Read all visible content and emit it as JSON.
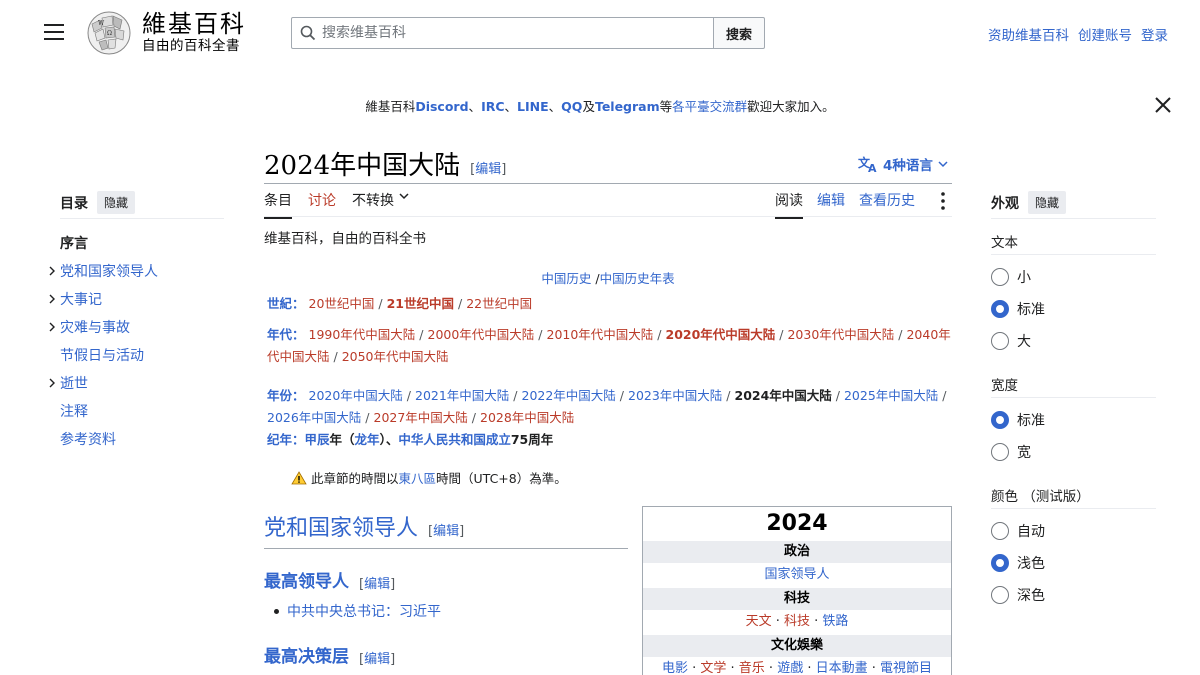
{
  "header": {
    "logo_title": "維基百科",
    "logo_subtitle": "自由的百科全書",
    "search_placeholder": "搜索维基百科",
    "search_button": "搜索",
    "user_links": [
      "资助维基百科",
      "创建账号",
      "登录"
    ]
  },
  "banner": {
    "prefix": "維基百科",
    "discord": "Discord",
    "sep1": "、",
    "irc": "IRC",
    "sep2": "、",
    "line": "LINE",
    "sep3": "、",
    "qq": "QQ",
    "and": "及",
    "telegram": "Telegram",
    "mid": "等",
    "platforms": "各平臺交流群",
    "suffix": "歡迎大家加入。"
  },
  "page": {
    "title": "2024年中国大陆",
    "edit": "编辑",
    "languages": "4种语言",
    "tagline": "维基百科，自由的百科全书"
  },
  "tabs": {
    "left": [
      "条目",
      "讨论",
      "不转换"
    ],
    "right": [
      "阅读",
      "编辑",
      "查看历史"
    ]
  },
  "toc": {
    "title": "目录",
    "hide": "隐藏",
    "items": [
      {
        "label": "序言",
        "expandable": false,
        "current": true
      },
      {
        "label": "党和国家领导人",
        "expandable": true,
        "current": false
      },
      {
        "label": "大事记",
        "expandable": true,
        "current": false
      },
      {
        "label": "灾难与事故",
        "expandable": true,
        "current": false
      },
      {
        "label": "节假日与活动",
        "expandable": false,
        "current": false
      },
      {
        "label": "逝世",
        "expandable": true,
        "current": false
      },
      {
        "label": "注释",
        "expandable": false,
        "current": false
      },
      {
        "label": "参考资料",
        "expandable": false,
        "current": false
      }
    ]
  },
  "appearance": {
    "title": "外观",
    "hide": "隐藏",
    "groups": [
      {
        "label": "文本",
        "options": [
          "小",
          "标准",
          "大"
        ],
        "selected": "标准"
      },
      {
        "label": "宽度",
        "options": [
          "标准",
          "宽"
        ],
        "selected": "标准"
      },
      {
        "label": "颜色 （测试版）",
        "options": [
          "自动",
          "浅色",
          "深色"
        ],
        "selected": "浅色"
      }
    ]
  },
  "navbox": {
    "top": [
      "中国历史",
      "中国历史年表"
    ],
    "century_label": "世紀：",
    "centuries": [
      "20世纪中国",
      "21世纪中国",
      "22世纪中国"
    ],
    "decade_label": "年代：",
    "decades": [
      "1990年代中国大陆",
      "2000年代中国大陆",
      "2010年代中国大陆",
      "2020年代中国大陆",
      "2030年代中国大陆",
      "2040年代中国大陆",
      "2050年代中国大陆"
    ],
    "year_label": "年份：",
    "years": [
      "2020年中国大陆",
      "2021年中国大陆",
      "2022年中国大陆",
      "2023年中国大陆",
      "2024年中国大陆",
      "2025年中国大陆",
      "2026年中国大陆",
      "2027年中国大陆",
      "2028年中国大陆"
    ],
    "era_label": "纪年：",
    "era_jiachen": "甲辰",
    "era_nian": "年（",
    "era_long": "龙年",
    "era_close": "）、",
    "era_prc": "中华人民共和国成立",
    "era_years": "75周年"
  },
  "notice": {
    "prefix": "此章節的時間以",
    "link": "東八區",
    "suffix": "時間（UTC+8）為準。"
  },
  "content": {
    "h2": "党和国家领导人",
    "h3_1": "最高领导人",
    "bullet_label": "中共中央总书记：",
    "bullet_link": "习近平",
    "h3_2": "最高决策层"
  },
  "infobox": {
    "year": "2024",
    "politics": "政治",
    "leaders": "国家领导人",
    "tech": "科技",
    "tech_items": [
      "天文",
      "科技",
      "铁路"
    ],
    "culture": "文化娛樂",
    "culture_items": [
      "电影",
      "文学",
      "音乐",
      "遊戲",
      "日本動畫",
      "電視節目"
    ]
  },
  "colors": {
    "link": "#3366cc",
    "red_link": "#ba3b29",
    "border": "#a2a9b1"
  }
}
